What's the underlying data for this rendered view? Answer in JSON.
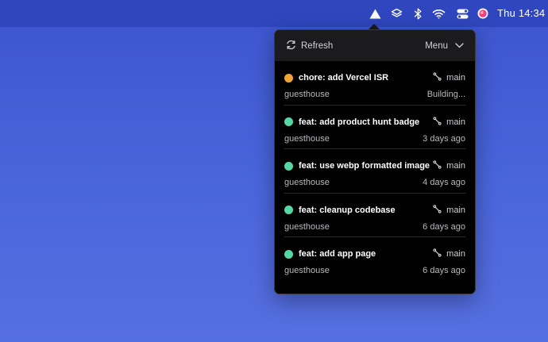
{
  "menubar": {
    "clock": "Thu 14:34",
    "icons": [
      "vercel-triangle-icon",
      "layers-icon",
      "bluetooth-icon",
      "wifi-icon",
      "control-center-icon",
      "siri-icon"
    ]
  },
  "popover": {
    "refresh_label": "Refresh",
    "menu_label": "Menu",
    "deployments": [
      {
        "title": "chore: add Vercel ISR",
        "branch": "main",
        "project": "guesthouse",
        "time": "Building...",
        "status": "building",
        "status_color": "#f0a33a"
      },
      {
        "title": "feat: add product hunt badge",
        "branch": "main",
        "project": "guesthouse",
        "time": "3 days ago",
        "status": "ready",
        "status_color": "#58d6a6"
      },
      {
        "title": "feat: use webp formatted image",
        "branch": "main",
        "project": "guesthouse",
        "time": "4 days ago",
        "status": "ready",
        "status_color": "#58d6a6"
      },
      {
        "title": "feat: cleanup codebase",
        "branch": "main",
        "project": "guesthouse",
        "time": "6 days ago",
        "status": "ready",
        "status_color": "#58d6a6"
      },
      {
        "title": "feat: add app page",
        "branch": "main",
        "project": "guesthouse",
        "time": "6 days ago",
        "status": "ready",
        "status_color": "#58d6a6"
      }
    ]
  }
}
